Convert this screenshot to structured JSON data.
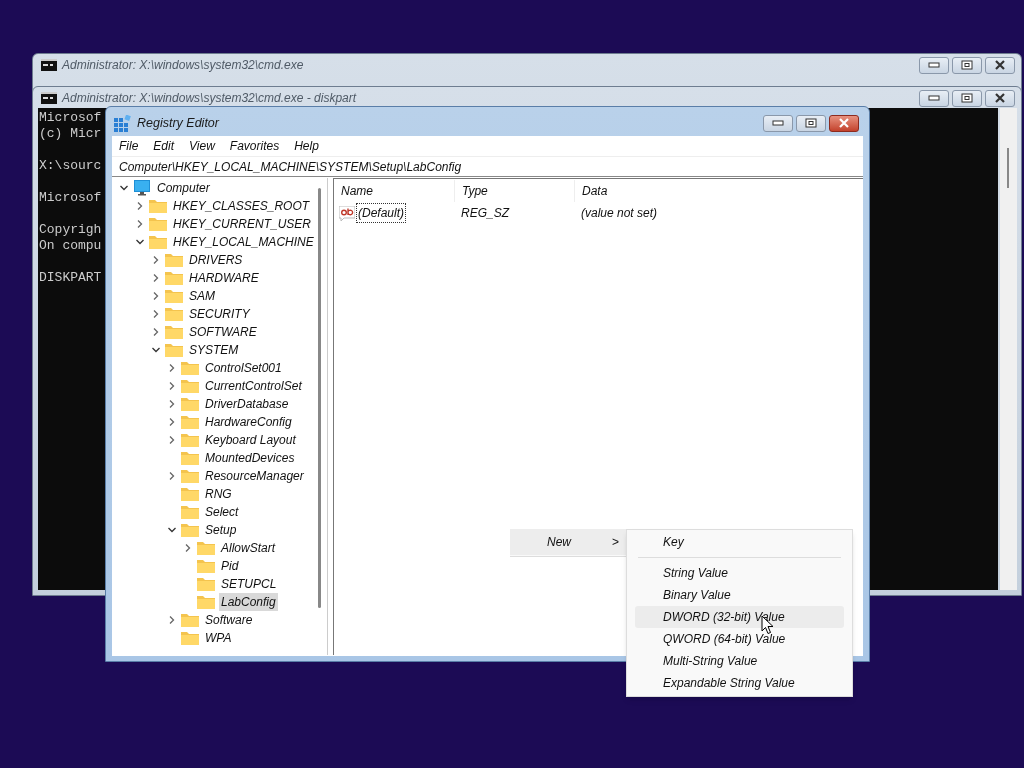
{
  "background_windows": [
    {
      "title": "Administrator: X:\\windows\\system32\\cmd.exe"
    },
    {
      "title": "Administrator: X:\\windows\\system32\\cmd.exe - diskpart",
      "console_paragraphs": [
        [
          "Microsof",
          "(c) Micr"
        ],
        [
          "X:\\sourc"
        ],
        [
          "Microsof"
        ],
        [
          "Copyrigh",
          "On compu"
        ],
        [
          "DISKPART"
        ]
      ]
    }
  ],
  "window": {
    "title": "Registry Editor"
  },
  "menu": [
    "File",
    "Edit",
    "View",
    "Favorites",
    "Help"
  ],
  "address": "Computer\\HKEY_LOCAL_MACHINE\\SYSTEM\\Setup\\LabConfig",
  "tree": [
    {
      "label": "Computer",
      "kind": "computer",
      "expanded": true,
      "selected": false,
      "children": [
        {
          "label": "HKEY_CLASSES_ROOT",
          "kind": "key",
          "expanded": false,
          "selected": false
        },
        {
          "label": "HKEY_CURRENT_USER",
          "kind": "key",
          "expanded": false,
          "selected": false
        },
        {
          "label": "HKEY_LOCAL_MACHINE",
          "kind": "key",
          "expanded": true,
          "selected": false,
          "children": [
            {
              "label": "DRIVERS",
              "kind": "key",
              "expanded": false,
              "selected": false
            },
            {
              "label": "HARDWARE",
              "kind": "key",
              "expanded": false,
              "selected": false
            },
            {
              "label": "SAM",
              "kind": "key",
              "expanded": false,
              "selected": false
            },
            {
              "label": "SECURITY",
              "kind": "key",
              "expanded": false,
              "selected": false
            },
            {
              "label": "SOFTWARE",
              "kind": "key",
              "expanded": false,
              "selected": false
            },
            {
              "label": "SYSTEM",
              "kind": "key",
              "expanded": true,
              "selected": false,
              "children": [
                {
                  "label": "ControlSet001",
                  "kind": "key",
                  "expanded": false,
                  "selected": false
                },
                {
                  "label": "CurrentControlSet",
                  "kind": "key",
                  "expanded": false,
                  "selected": false
                },
                {
                  "label": "DriverDatabase",
                  "kind": "key",
                  "expanded": false,
                  "selected": false
                },
                {
                  "label": "HardwareConfig",
                  "kind": "key",
                  "expanded": false,
                  "selected": false
                },
                {
                  "label": "Keyboard Layout",
                  "kind": "key",
                  "expanded": false,
                  "selected": false
                },
                {
                  "label": "MountedDevices",
                  "kind": "leaf",
                  "selected": false
                },
                {
                  "label": "ResourceManager",
                  "kind": "key",
                  "expanded": false,
                  "selected": false
                },
                {
                  "label": "RNG",
                  "kind": "leaf",
                  "selected": false
                },
                {
                  "label": "Select",
                  "kind": "leaf",
                  "selected": false
                },
                {
                  "label": "Setup",
                  "kind": "key",
                  "expanded": true,
                  "selected": false,
                  "children": [
                    {
                      "label": "AllowStart",
                      "kind": "key",
                      "expanded": false,
                      "selected": false
                    },
                    {
                      "label": "Pid",
                      "kind": "leaf",
                      "selected": false
                    },
                    {
                      "label": "SETUPCL",
                      "kind": "leaf",
                      "selected": false
                    },
                    {
                      "label": "LabConfig",
                      "kind": "leaf",
                      "selected": true
                    }
                  ]
                },
                {
                  "label": "Software",
                  "kind": "key",
                  "expanded": false,
                  "selected": false
                },
                {
                  "label": "WPA",
                  "kind": "leaf",
                  "selected": false
                }
              ]
            }
          ]
        }
      ]
    }
  ],
  "table": {
    "columns": [
      "Name",
      "Type",
      "Data"
    ],
    "rows": [
      {
        "name": "(Default)",
        "type": "REG_SZ",
        "data": "(value not set)"
      }
    ]
  },
  "context_menu": {
    "items": [
      {
        "label": "New",
        "submenu_arrow": ">",
        "highlighted": true
      }
    ]
  },
  "submenu": {
    "items": [
      {
        "label": "Key",
        "kind": "item",
        "highlighted": false
      },
      {
        "kind": "separator"
      },
      {
        "label": "String Value",
        "kind": "item",
        "highlighted": false
      },
      {
        "label": "Binary Value",
        "kind": "item",
        "highlighted": false
      },
      {
        "label": "DWORD (32-bit) Value",
        "kind": "item",
        "highlighted": true
      },
      {
        "label": "QWORD (64-bit) Value",
        "kind": "item",
        "highlighted": false
      },
      {
        "label": "Multi-String Value",
        "kind": "item",
        "highlighted": false
      },
      {
        "label": "Expandable String Value",
        "kind": "item",
        "highlighted": false
      }
    ]
  }
}
